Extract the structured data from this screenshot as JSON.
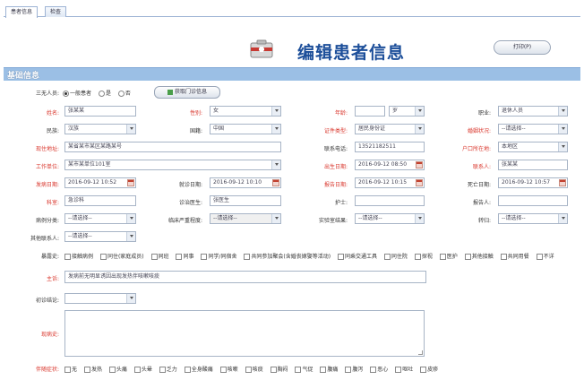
{
  "tabs": [
    "患者信息",
    "检查"
  ],
  "header": {
    "title": "编辑患者信息",
    "print_button": "打印(P)"
  },
  "section_title": "基础信息",
  "row0": {
    "label": "三无人员:",
    "options": [
      "一般患者",
      "是",
      "否"
    ],
    "selected": 0,
    "fetch_button": "获取门诊信息"
  },
  "row1": {
    "name_label": "姓名:",
    "name_value": "张某某",
    "gender_label": "性别:",
    "gender_value": "女",
    "age_label": "年龄:",
    "age_value": "",
    "age_unit": "岁",
    "occupation_label": "职业:",
    "occupation_value": "退休人员"
  },
  "row2": {
    "ethnic_label": "民族:",
    "ethnic_value": "汉族",
    "nationality_label": "国籍:",
    "nationality_value": "中国",
    "idtype_label": "证件类型:",
    "idtype_value": "居民身份证",
    "marital_label": "婚姻状况:",
    "marital_value": "--请选择--"
  },
  "row3": {
    "address_label": "现住地址:",
    "address_value": "某省某市某区某路某号",
    "phone_label": "联系电话:",
    "phone_value": "13521182511",
    "region_label": "户口所在地:",
    "region_value": "本地区"
  },
  "row4": {
    "unit_label": "工作单位:",
    "unit_value": "某市某单位101室",
    "birth_label": "出生日期:",
    "birth_value": "2016-09-12 08:50",
    "contact_label": "联系人:",
    "contact_value": "张某某"
  },
  "row5": {
    "onset_label": "发病日期:",
    "onset_value": "2016-09-12 10:52",
    "visit_label": "就诊日期:",
    "visit_value": "2016-09-12 10:10",
    "report_label": "报告日期:",
    "report_value": "2016-09-12 10:15",
    "death_label": "死亡日期:",
    "death_value": "2016-09-12 10:57"
  },
  "row6": {
    "dept_label": "科室:",
    "dept_value": "急诊科",
    "doctor_label": "诊治医生:",
    "doctor_value": "张医生",
    "nurse_label": "护士:",
    "nurse_value": "",
    "reporter_label": "报告人:",
    "reporter_value": ""
  },
  "row7": {
    "a_label": "病例分类:",
    "a_value": "--请选择--",
    "b_label": "临床严重程度:",
    "b_value": "--请选择--",
    "c_label": "实验室结果:",
    "c_value": "--请选择--",
    "d_label": "转归:",
    "d_value": "--请选择--"
  },
  "row8": {
    "label": "其他联系人:",
    "value": "--请选择--"
  },
  "row9": {
    "label": "暴露史:",
    "options": [
      "接触病例",
      "同住(家庭成员)",
      "同班",
      "同事",
      "同学/同宿舍",
      "共同参加聚会(含婚丧嫁娶等活动)",
      "同乘交通工具",
      "同住院",
      "探视",
      "医护",
      "其他接触",
      "共同用餐",
      "不详"
    ]
  },
  "row10": {
    "label": "主诉:",
    "value": "发病前无明显诱因出现发热伴咳嗽咳痰"
  },
  "row11": {
    "label": "初诊结论:",
    "value": ""
  },
  "row12": {
    "label": "现病史:",
    "value": ""
  },
  "row13": {
    "label": "伴随症状:",
    "options": [
      "无",
      "发热",
      "头痛",
      "头晕",
      "乏力",
      "全身酸痛",
      "咳嗽",
      "咳痰",
      "胸闷",
      "气促",
      "腹痛",
      "腹泻",
      "恶心",
      "呕吐",
      "皮疹"
    ]
  }
}
